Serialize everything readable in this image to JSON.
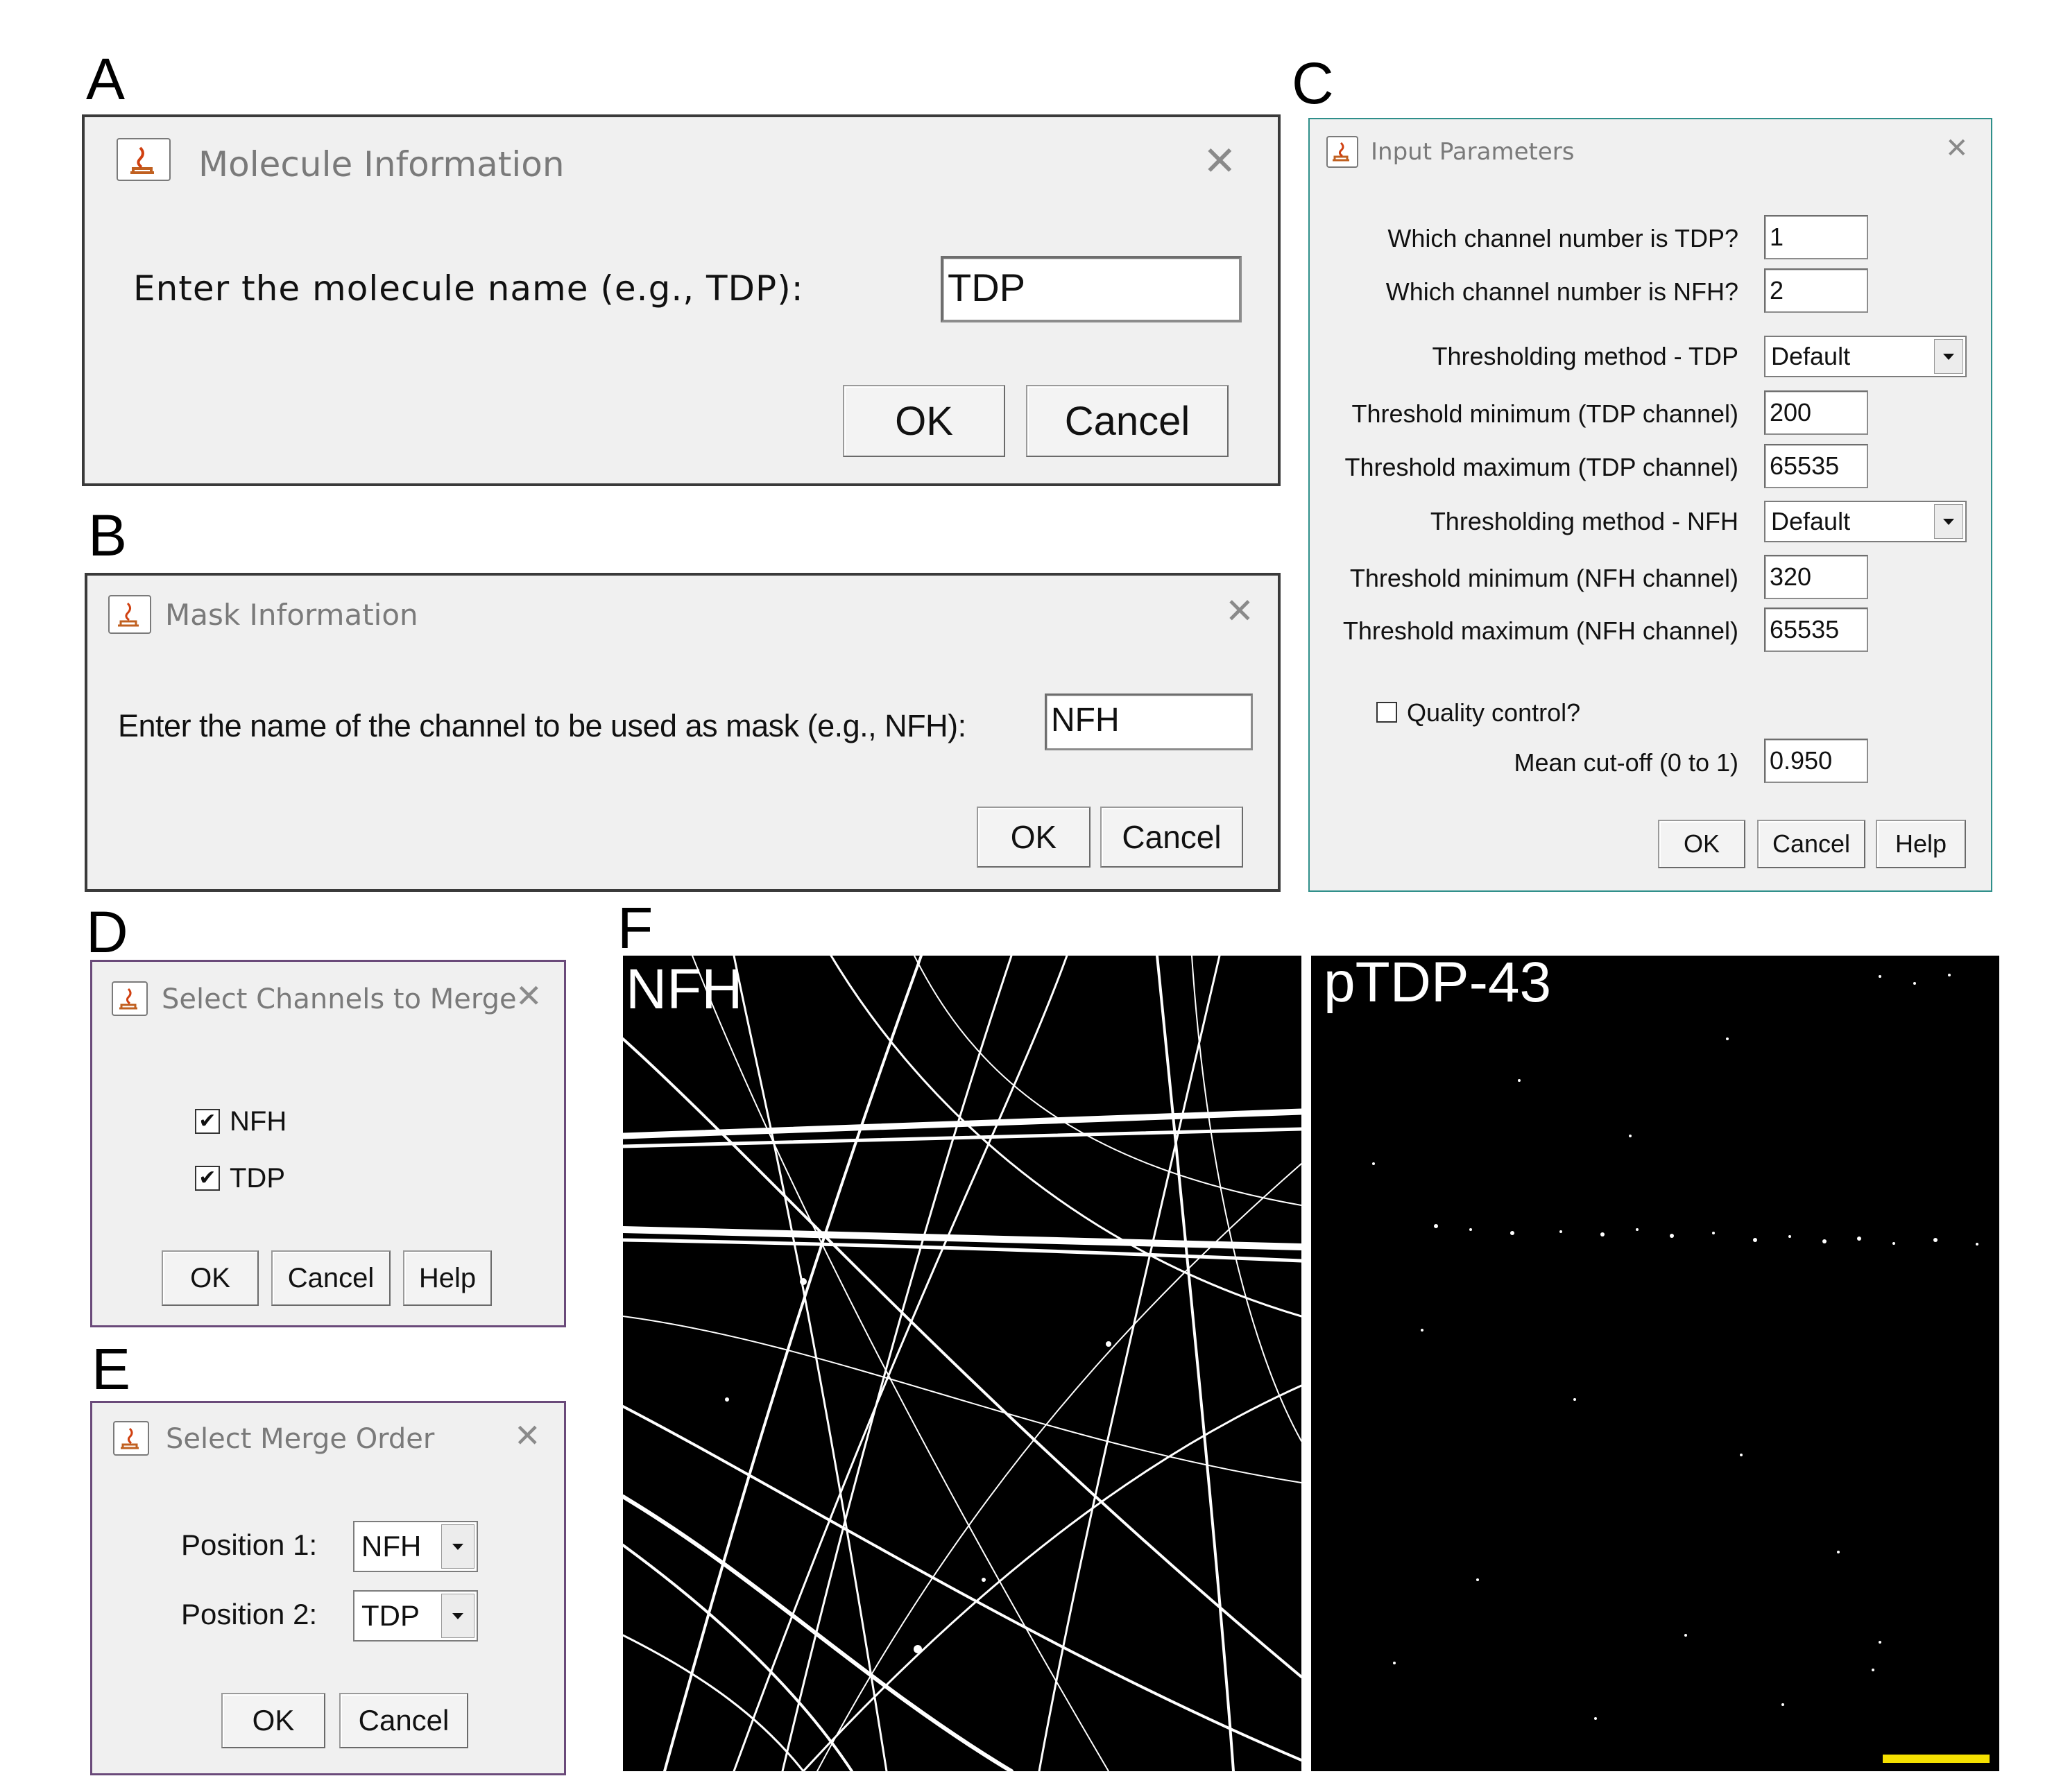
{
  "panels": {
    "A": {
      "letter": "A",
      "title": "Molecule Information",
      "prompt": "Enter the molecule name (e.g., TDP):",
      "input_value": "TDP",
      "ok_label": "OK",
      "cancel_label": "Cancel",
      "close_glyph": "✕"
    },
    "B": {
      "letter": "B",
      "title": "Mask Information",
      "prompt": "Enter the name of the channel to be used as mask (e.g., NFH):",
      "input_value": "NFH",
      "ok_label": "OK",
      "cancel_label": "Cancel",
      "close_glyph": "✕"
    },
    "C": {
      "letter": "C",
      "title": "Input Parameters",
      "close_glyph": "✕",
      "fields": [
        {
          "label": "Which channel number is TDP?",
          "value": "1"
        },
        {
          "label": "Which channel number is NFH?",
          "value": "2"
        },
        {
          "label": "Thresholding method - TDP",
          "value": "Default"
        },
        {
          "label": "Threshold minimum (TDP channel)",
          "value": "200"
        },
        {
          "label": "Threshold maximum (TDP channel)",
          "value": "65535"
        },
        {
          "label": "Thresholding method - NFH",
          "value": "Default"
        },
        {
          "label": "Threshold minimum (NFH channel)",
          "value": "320"
        },
        {
          "label": "Threshold maximum (NFH channel)",
          "value": "65535"
        }
      ],
      "quality_control_label": "Quality control?",
      "quality_control_checked": false,
      "cutoff_label": "Mean cut-off (0 to 1)",
      "cutoff_value": "0.950",
      "ok_label": "OK",
      "cancel_label": "Cancel",
      "help_label": "Help"
    },
    "D": {
      "letter": "D",
      "title": "Select Channels to Merge",
      "close_glyph": "✕",
      "options": [
        {
          "label": "NFH",
          "checked": true,
          "mark": "✔"
        },
        {
          "label": "TDP",
          "checked": true,
          "mark": "✔"
        }
      ],
      "ok_label": "OK",
      "cancel_label": "Cancel",
      "help_label": "Help"
    },
    "E": {
      "letter": "E",
      "title": "Select Merge Order",
      "close_glyph": "✕",
      "positions": [
        {
          "label": "Position 1:",
          "value": "NFH"
        },
        {
          "label": "Position 2:",
          "value": "TDP"
        }
      ],
      "ok_label": "OK",
      "cancel_label": "Cancel"
    },
    "F": {
      "letter": "F",
      "images": [
        {
          "label": "NFH",
          "background": "#000000",
          "foreground": "#ffffff"
        },
        {
          "label": "pTDP-43",
          "background": "#000000",
          "foreground": "#ffffff"
        }
      ],
      "scale_bar_color": "#f5e000"
    }
  },
  "icons": {
    "title_icon": "java-cup-icon",
    "close_icon": "close-icon",
    "dropdown_icon": "chevron-down-icon"
  },
  "colors": {
    "dialog_bg": "#f0f0f0",
    "title_text": "#7a7a7a",
    "dialog_border_D_E": "#6a4a7a",
    "dialog_border_C": "#2f8f8a"
  }
}
